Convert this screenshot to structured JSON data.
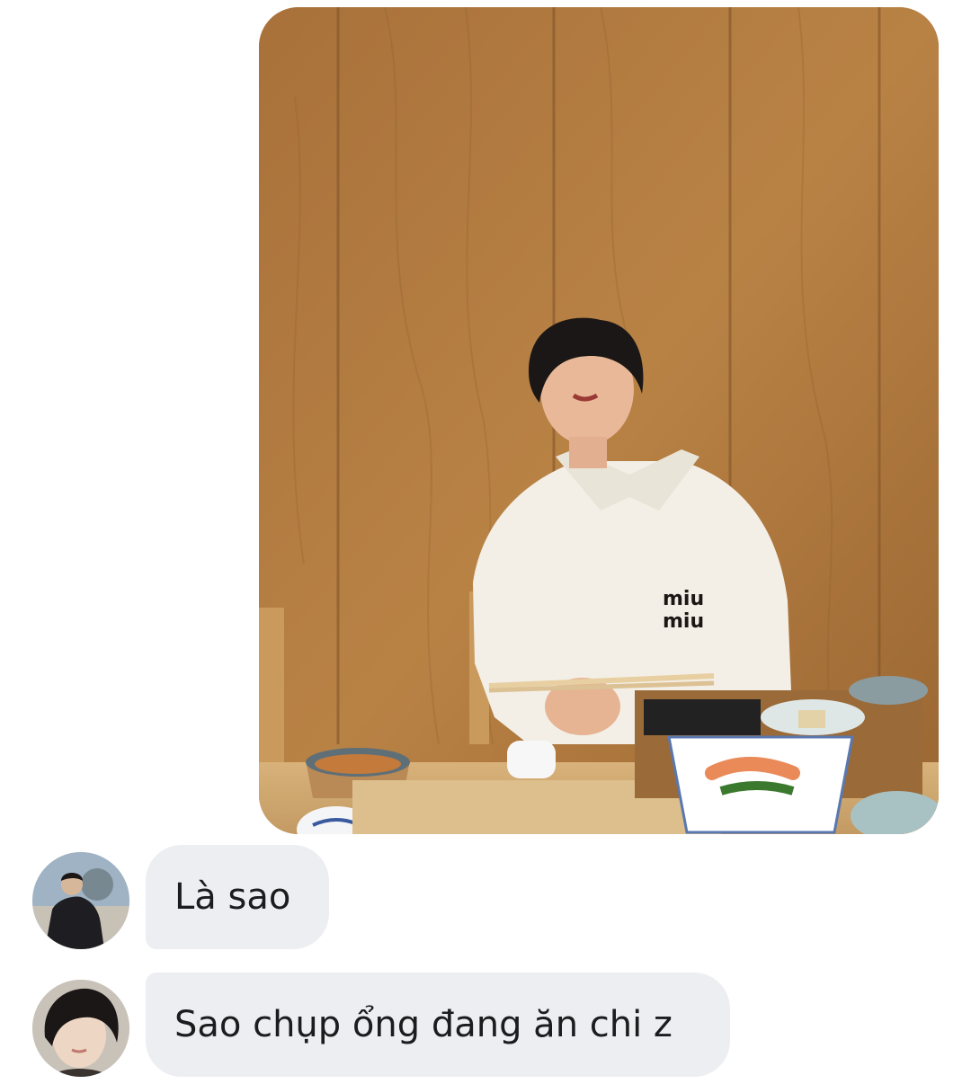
{
  "conversation": {
    "photo": {
      "alt": "Photo",
      "logo_text": "miu miu"
    },
    "messages": [
      {
        "sender": "friend-1",
        "text": "Là sao"
      },
      {
        "sender": "friend-2",
        "text": "Sao chụp ổng đang ăn chi z"
      }
    ]
  },
  "colors": {
    "received_bubble": "#edeef2",
    "text": "#1c1c1e",
    "background": "#ffffff"
  },
  "icons": [
    "avatar-photo-1",
    "avatar-photo-2"
  ]
}
